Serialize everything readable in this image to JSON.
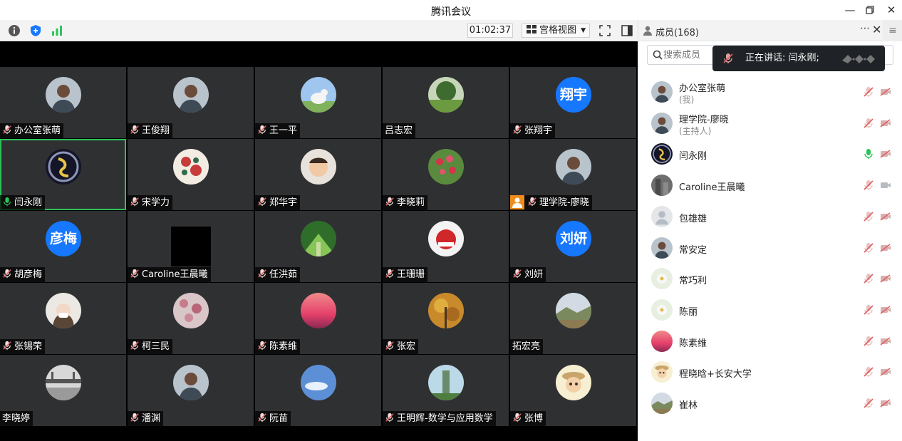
{
  "app": {
    "title": "腾讯会议"
  },
  "toolbar": {
    "timer": "01:02:37",
    "view_mode": "宫格视图"
  },
  "grid": {
    "tiles": [
      {
        "name": "办公室张萌",
        "mic": "muted",
        "avatar": "photo-person"
      },
      {
        "name": "王俊翔",
        "mic": "muted",
        "avatar": "photo-person"
      },
      {
        "name": "王一平",
        "mic": "muted",
        "avatar": "photo-animal"
      },
      {
        "name": "吕志宏",
        "mic": "none",
        "avatar": "photo-garden"
      },
      {
        "name": "张翔宇",
        "mic": "muted",
        "avatar_text": "翔宇"
      },
      {
        "name": "闫永刚",
        "mic": "speaking",
        "avatar": "photo-logo",
        "active": true
      },
      {
        "name": "宋学力",
        "mic": "muted",
        "avatar": "photo-pattern"
      },
      {
        "name": "郑华宇",
        "mic": "muted",
        "avatar": "photo-baby"
      },
      {
        "name": "李晓莉",
        "mic": "muted",
        "avatar": "photo-tulips"
      },
      {
        "name": "理学院-廖晓",
        "mic": "muted",
        "avatar": "photo-person",
        "host_badge": true
      },
      {
        "name": "胡彦梅",
        "mic": "muted",
        "avatar_text": "彦梅"
      },
      {
        "name": "Caroline王晨曦",
        "mic": "muted",
        "avatar": "video-dark"
      },
      {
        "name": "任洪茹",
        "mic": "muted",
        "avatar": "photo-forest"
      },
      {
        "name": "王珊珊",
        "mic": "muted",
        "avatar": "photo-red"
      },
      {
        "name": "刘妍",
        "mic": "muted",
        "avatar_text": "刘妍"
      },
      {
        "name": "张锡荣",
        "mic": "muted",
        "avatar": "photo-girl"
      },
      {
        "name": "柯三民",
        "mic": "muted",
        "avatar": "photo-blossom"
      },
      {
        "name": "陈素维",
        "mic": "muted",
        "avatar": "photo-sunset"
      },
      {
        "name": "张宏",
        "mic": "muted",
        "avatar": "photo-autumn"
      },
      {
        "name": "拓宏亮",
        "mic": "none",
        "avatar": "photo-landscape"
      },
      {
        "name": "李晓婷",
        "mic": "none",
        "avatar": "photo-bridge"
      },
      {
        "name": "潘渊",
        "mic": "muted",
        "avatar": "photo-person"
      },
      {
        "name": "阮苗",
        "mic": "muted",
        "avatar": "photo-sky"
      },
      {
        "name": "王明辉-数学与应用数学",
        "mic": "muted",
        "avatar": "photo-tower"
      },
      {
        "name": "张博",
        "mic": "muted",
        "avatar": "photo-cartoon"
      }
    ]
  },
  "panel": {
    "title": "成员(168)",
    "search_placeholder": "搜索成员",
    "speaking_label": "正在讲话: 闫永刚;",
    "members": [
      {
        "name": "办公室张萌",
        "sub": "(我)",
        "mic": "muted",
        "cam": "off",
        "avatar": "photo-person"
      },
      {
        "name": "理学院-廖晓",
        "sub": "(主持人)",
        "mic": "muted",
        "cam": "off",
        "avatar": "photo-person"
      },
      {
        "name": "闫永刚",
        "mic": "speaking",
        "cam": "off",
        "avatar": "photo-logo"
      },
      {
        "name": "Caroline王晨曦",
        "mic": "muted",
        "cam": "on",
        "avatar": "photo-building"
      },
      {
        "name": "包雄雄",
        "mic": "muted",
        "cam": "off",
        "avatar": "default-user"
      },
      {
        "name": "常安定",
        "mic": "muted",
        "cam": "off",
        "avatar": "photo-person"
      },
      {
        "name": "常巧利",
        "mic": "muted",
        "cam": "off",
        "avatar": "photo-flower"
      },
      {
        "name": "陈丽",
        "mic": "muted",
        "cam": "off",
        "avatar": "photo-flower"
      },
      {
        "name": "陈素维",
        "mic": "muted",
        "cam": "off",
        "avatar": "photo-sunset"
      },
      {
        "name": "程晓晗+长安大学",
        "mic": "muted",
        "cam": "off",
        "avatar": "photo-cartoon"
      },
      {
        "name": "崔林",
        "mic": "muted",
        "cam": "off",
        "avatar": "photo-landscape"
      }
    ]
  },
  "colors": {
    "accent": "#1677ff",
    "speaking": "#2ec25a",
    "muted": "#e57373",
    "tile_bg": "#2f3032"
  }
}
